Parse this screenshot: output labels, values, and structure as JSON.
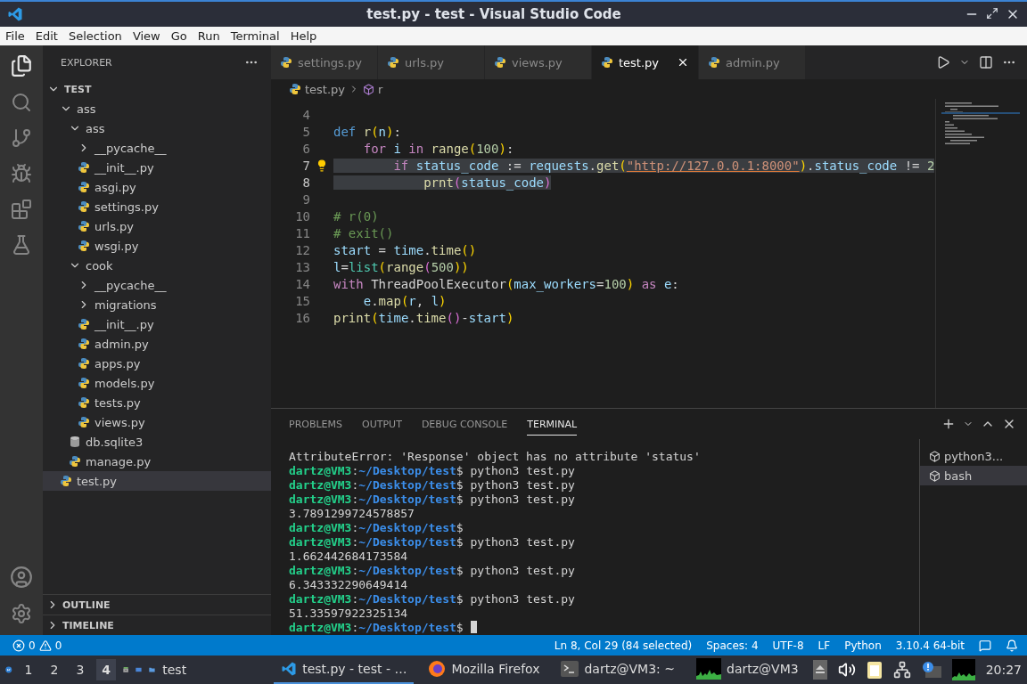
{
  "window": {
    "title": "test.py - test - Visual Studio Code"
  },
  "menu": [
    "File",
    "Edit",
    "Selection",
    "View",
    "Go",
    "Run",
    "Terminal",
    "Help"
  ],
  "sidebar": {
    "title": "EXPLORER",
    "root": {
      "name": "TEST",
      "expanded": true,
      "children": [
        {
          "name": "ass",
          "kind": "folder",
          "expanded": true,
          "selected": false,
          "children": [
            {
              "name": "ass",
              "kind": "folder",
              "expanded": true,
              "selected": false,
              "children": [
                {
                  "name": "__pycache__",
                  "kind": "folder",
                  "expanded": false,
                  "selected": false
                },
                {
                  "name": "__init__.py",
                  "kind": "python",
                  "selected": false
                },
                {
                  "name": "asgi.py",
                  "kind": "python",
                  "selected": false
                },
                {
                  "name": "settings.py",
                  "kind": "python",
                  "selected": false
                },
                {
                  "name": "urls.py",
                  "kind": "python",
                  "selected": false
                },
                {
                  "name": "wsgi.py",
                  "kind": "python",
                  "selected": false
                }
              ]
            },
            {
              "name": "cook",
              "kind": "folder",
              "expanded": true,
              "selected": false,
              "children": [
                {
                  "name": "__pycache__",
                  "kind": "folder",
                  "expanded": false,
                  "selected": false
                },
                {
                  "name": "migrations",
                  "kind": "folder",
                  "expanded": false,
                  "selected": false
                },
                {
                  "name": "__init__.py",
                  "kind": "python",
                  "selected": false
                },
                {
                  "name": "admin.py",
                  "kind": "python",
                  "selected": false
                },
                {
                  "name": "apps.py",
                  "kind": "python",
                  "selected": false
                },
                {
                  "name": "models.py",
                  "kind": "python",
                  "selected": false
                },
                {
                  "name": "tests.py",
                  "kind": "python",
                  "selected": false
                },
                {
                  "name": "views.py",
                  "kind": "python",
                  "selected": false
                }
              ]
            },
            {
              "name": "db.sqlite3",
              "kind": "database",
              "selected": false
            },
            {
              "name": "manage.py",
              "kind": "python",
              "selected": false
            }
          ]
        },
        {
          "name": "test.py",
          "kind": "python",
          "selected": true
        }
      ]
    },
    "sections": [
      {
        "name": "OUTLINE",
        "expanded": false
      },
      {
        "name": "TIMELINE",
        "expanded": false
      }
    ]
  },
  "tabs": [
    {
      "label": "settings.py",
      "selected": false
    },
    {
      "label": "urls.py",
      "selected": false
    },
    {
      "label": "views.py",
      "selected": false
    },
    {
      "label": "test.py",
      "selected": true
    },
    {
      "label": "admin.py",
      "selected": false
    }
  ],
  "breadcrumb": [
    "test.py",
    "r"
  ],
  "code": [
    {
      "number": "4",
      "selected": false,
      "hint": false
    },
    {
      "number": "5",
      "selected": false,
      "hint": false,
      "tokens": [
        {
          "text": "def ",
          "kind": "keyword"
        },
        {
          "text": "r",
          "kind": "func"
        },
        {
          "text": "(",
          "kind": "bracket"
        },
        {
          "text": "n",
          "kind": "param"
        },
        {
          "text": ")",
          "kind": "bracket"
        },
        {
          "text": ":",
          "kind": "plain"
        }
      ]
    },
    {
      "number": "6",
      "selected": false,
      "hint": false,
      "tokens": [
        {
          "text": "    for ",
          "kind": "control"
        },
        {
          "text": "i",
          "kind": "param"
        },
        {
          "text": " in ",
          "kind": "control"
        },
        {
          "text": "range",
          "kind": "func"
        },
        {
          "text": "(",
          "kind": "bracket"
        },
        {
          "text": "100",
          "kind": "number"
        },
        {
          "text": ")",
          "kind": "bracket"
        },
        {
          "text": ":",
          "kind": "plain"
        }
      ]
    },
    {
      "number": "7",
      "selected": true,
      "hint": true,
      "tokens": [
        {
          "text": "        if ",
          "kind": "control"
        },
        {
          "text": "status_code",
          "kind": "param"
        },
        {
          "text": " := ",
          "kind": "plain"
        },
        {
          "text": "requests",
          "kind": "param"
        },
        {
          "text": ".",
          "kind": "plain"
        },
        {
          "text": "get",
          "kind": "func"
        },
        {
          "text": "(",
          "kind": "bracket"
        },
        {
          "text": "\"http://127.0.0.1:8000\"",
          "kind": "string"
        },
        {
          "text": ")",
          "kind": "bracket"
        },
        {
          "text": ".",
          "kind": "plain"
        },
        {
          "text": "status_code",
          "kind": "param"
        },
        {
          "text": " != ",
          "kind": "plain"
        },
        {
          "text": "2",
          "kind": "number"
        }
      ]
    },
    {
      "number": "8",
      "selected": true,
      "hint": false,
      "tokens": [
        {
          "text": "            prnt",
          "kind": "func"
        },
        {
          "text": "(",
          "kind": "bracket2"
        },
        {
          "text": "status_code",
          "kind": "param"
        },
        {
          "text": ")",
          "kind": "bracket2"
        }
      ]
    },
    {
      "number": "9",
      "selected": false,
      "hint": false
    },
    {
      "number": "10",
      "selected": false,
      "hint": false,
      "tokens": [
        {
          "text": "# r(0)",
          "kind": "comment"
        }
      ]
    },
    {
      "number": "11",
      "selected": false,
      "hint": false,
      "tokens": [
        {
          "text": "# exit()",
          "kind": "comment"
        }
      ]
    },
    {
      "number": "12",
      "selected": false,
      "hint": false,
      "tokens": [
        {
          "text": "start",
          "kind": "param"
        },
        {
          "text": " = ",
          "kind": "plain"
        },
        {
          "text": "time",
          "kind": "param"
        },
        {
          "text": ".",
          "kind": "plain"
        },
        {
          "text": "time",
          "kind": "func"
        },
        {
          "text": "()",
          "kind": "bracket"
        }
      ]
    },
    {
      "number": "13",
      "selected": false,
      "hint": false,
      "tokens": [
        {
          "text": "l",
          "kind": "param"
        },
        {
          "text": "=",
          "kind": "plain"
        },
        {
          "text": "list",
          "kind": "builtin"
        },
        {
          "text": "(",
          "kind": "bracket"
        },
        {
          "text": "range",
          "kind": "func"
        },
        {
          "text": "(",
          "kind": "bracket2"
        },
        {
          "text": "500",
          "kind": "number"
        },
        {
          "text": "))",
          "kind": "bracket"
        }
      ]
    },
    {
      "number": "14",
      "selected": false,
      "hint": false,
      "tokens": [
        {
          "text": "with ",
          "kind": "control"
        },
        {
          "text": "ThreadPoolExecutor",
          "kind": "plain"
        },
        {
          "text": "(",
          "kind": "bracket"
        },
        {
          "text": "max_workers",
          "kind": "param"
        },
        {
          "text": "=",
          "kind": "plain"
        },
        {
          "text": "100",
          "kind": "number"
        },
        {
          "text": ")",
          "kind": "bracket"
        },
        {
          "text": " as ",
          "kind": "control"
        },
        {
          "text": "e",
          "kind": "param"
        },
        {
          "text": ":",
          "kind": "plain"
        }
      ]
    },
    {
      "number": "15",
      "selected": false,
      "hint": false,
      "tokens": [
        {
          "text": "    e",
          "kind": "param"
        },
        {
          "text": ".",
          "kind": "plain"
        },
        {
          "text": "map",
          "kind": "func"
        },
        {
          "text": "(",
          "kind": "bracket"
        },
        {
          "text": "r",
          "kind": "param"
        },
        {
          "text": ", ",
          "kind": "plain"
        },
        {
          "text": "l",
          "kind": "param"
        },
        {
          "text": ")",
          "kind": "bracket"
        }
      ]
    },
    {
      "number": "16",
      "selected": false,
      "hint": false,
      "tokens": [
        {
          "text": "print",
          "kind": "func"
        },
        {
          "text": "(",
          "kind": "bracket"
        },
        {
          "text": "time",
          "kind": "param"
        },
        {
          "text": ".",
          "kind": "plain"
        },
        {
          "text": "time",
          "kind": "func"
        },
        {
          "text": "()",
          "kind": "bracket2"
        },
        {
          "text": "-",
          "kind": "plain"
        },
        {
          "text": "start",
          "kind": "param"
        },
        {
          "text": ")",
          "kind": "bracket"
        }
      ]
    }
  ],
  "panel": {
    "tabs": [
      {
        "label": "PROBLEMS",
        "selected": false
      },
      {
        "label": "OUTPUT",
        "selected": false
      },
      {
        "label": "DEBUG CONSOLE",
        "selected": false
      },
      {
        "label": "TERMINAL",
        "selected": true
      }
    ],
    "terminal": {
      "cursor": true,
      "lines": [
        [
          {
            "text": "AttributeError: 'Response' object has no attribute 'status'",
            "kind": "plain"
          }
        ],
        [
          {
            "text": "dartz@VM3",
            "kind": "user"
          },
          {
            "text": ":",
            "kind": "plain"
          },
          {
            "text": "~/Desktop/test",
            "kind": "path"
          },
          {
            "text": "$ python3 test.py",
            "kind": "plain"
          }
        ],
        [
          {
            "text": "dartz@VM3",
            "kind": "user"
          },
          {
            "text": ":",
            "kind": "plain"
          },
          {
            "text": "~/Desktop/test",
            "kind": "path"
          },
          {
            "text": "$ python3 test.py",
            "kind": "plain"
          }
        ],
        [
          {
            "text": "dartz@VM3",
            "kind": "user"
          },
          {
            "text": ":",
            "kind": "plain"
          },
          {
            "text": "~/Desktop/test",
            "kind": "path"
          },
          {
            "text": "$ python3 test.py",
            "kind": "plain"
          }
        ],
        [
          {
            "text": "3.7891299724578857",
            "kind": "plain"
          }
        ],
        [
          {
            "text": "dartz@VM3",
            "kind": "user"
          },
          {
            "text": ":",
            "kind": "plain"
          },
          {
            "text": "~/Desktop/test",
            "kind": "path"
          },
          {
            "text": "$",
            "kind": "plain"
          }
        ],
        [
          {
            "text": "dartz@VM3",
            "kind": "user"
          },
          {
            "text": ":",
            "kind": "plain"
          },
          {
            "text": "~/Desktop/test",
            "kind": "path"
          },
          {
            "text": "$ python3 test.py",
            "kind": "plain"
          }
        ],
        [
          {
            "text": "1.662442684173584",
            "kind": "plain"
          }
        ],
        [
          {
            "text": "dartz@VM3",
            "kind": "user"
          },
          {
            "text": ":",
            "kind": "plain"
          },
          {
            "text": "~/Desktop/test",
            "kind": "path"
          },
          {
            "text": "$ python3 test.py",
            "kind": "plain"
          }
        ],
        [
          {
            "text": "6.343332290649414",
            "kind": "plain"
          }
        ],
        [
          {
            "text": "dartz@VM3",
            "kind": "user"
          },
          {
            "text": ":",
            "kind": "plain"
          },
          {
            "text": "~/Desktop/test",
            "kind": "path"
          },
          {
            "text": "$ python3 test.py",
            "kind": "plain"
          }
        ],
        [
          {
            "text": "51.33597922325134",
            "kind": "plain"
          }
        ],
        [
          {
            "text": "dartz@VM3",
            "kind": "user"
          },
          {
            "text": ":",
            "kind": "plain"
          },
          {
            "text": "~/Desktop/test",
            "kind": "path"
          },
          {
            "text": "$",
            "kind": "plain"
          }
        ]
      ]
    },
    "sessions": [
      {
        "label": "python3...",
        "selected": false
      },
      {
        "label": "bash",
        "selected": true
      }
    ]
  },
  "status_bar": {
    "errors": "0",
    "warnings": "0",
    "items": [
      "Ln 8, Col 29 (84 selected)",
      "Spaces: 4",
      "UTF-8",
      "LF",
      "Python",
      "3.10.4 64-bit"
    ]
  },
  "taskbar": {
    "workspaces": [
      {
        "label": "1",
        "selected": false
      },
      {
        "label": "2",
        "selected": false
      },
      {
        "label": "3",
        "selected": false
      },
      {
        "label": "4",
        "selected": true
      }
    ],
    "folder_label": "test",
    "windows": [
      {
        "label": "test.py - test - …",
        "kind": "vscode",
        "selected": true
      },
      {
        "label": "Mozilla Firefox",
        "kind": "firefox",
        "selected": false
      },
      {
        "label": "dartz@VM3: ~",
        "kind": "terminal",
        "selected": false
      },
      {
        "label": "dartz@VM3",
        "kind": "monitor",
        "selected": false
      }
    ],
    "clock": "20:27"
  }
}
